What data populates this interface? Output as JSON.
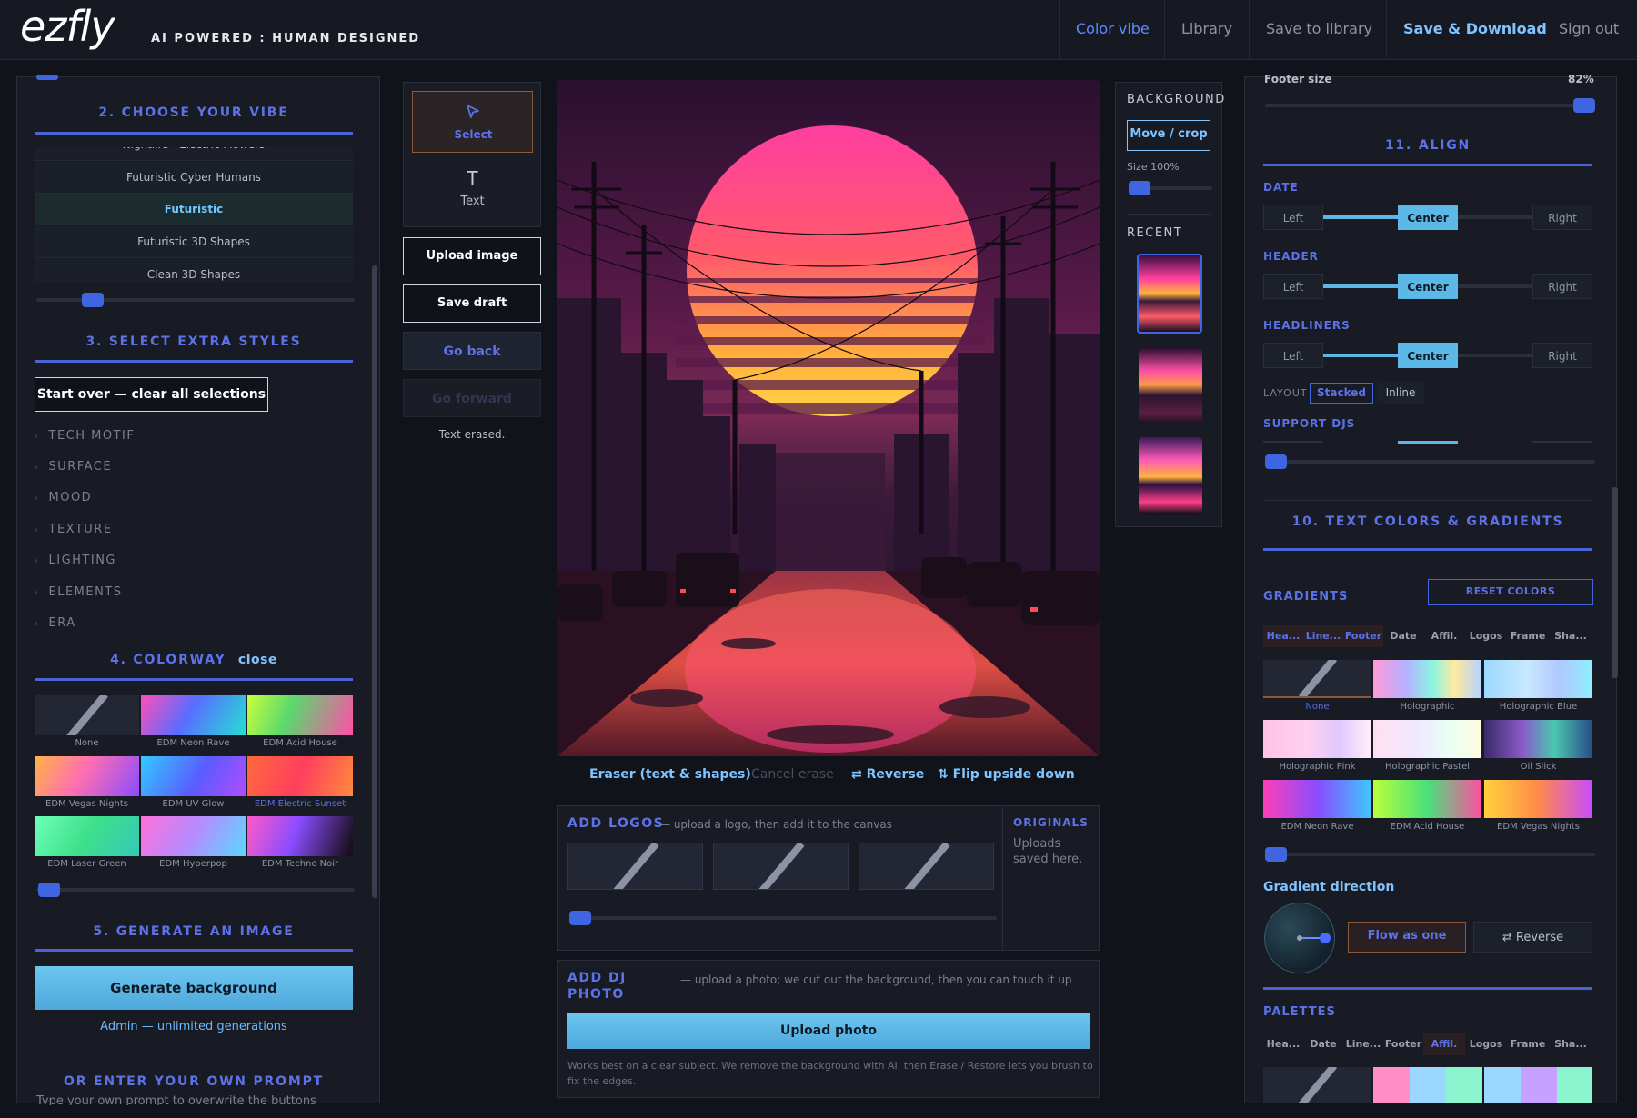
{
  "header": {
    "logo": "ezfly",
    "tagline": "AI POWERED : HUMAN DESIGNED",
    "nav": [
      "Color vibe",
      "Library",
      "Save to library",
      "Save & Download",
      "Sign out"
    ]
  },
  "left": {
    "vibe_title": "2.  CHOOSE YOUR VIBE",
    "vibe_list": [
      "Nightlife - Electric Flowers",
      "Futuristic Cyber Humans",
      "Futuristic",
      "Futuristic 3D Shapes",
      "Clean 3D Shapes"
    ],
    "vibe_selected": "Futuristic",
    "extra_title": "3.  SELECT EXTRA STYLES",
    "start_over": "Start over — clear all selections",
    "styles": [
      "TECH MOTIF",
      "SURFACE",
      "MOOD",
      "TEXTURE",
      "LIGHTING",
      "ELEMENTS",
      "ERA"
    ],
    "colorway_title": "4.  COLORWAY",
    "colorway_close": "close",
    "colorways": [
      "None",
      "EDM Neon Rave",
      "EDM Acid House",
      "EDM Vegas Nights",
      "EDM UV Glow",
      "EDM Electric Sunset",
      "EDM Laser Green",
      "EDM Hyperpop",
      "EDM Techno Noir"
    ],
    "generate_title": "5.  GENERATE AN IMAGE",
    "generate_button": "Generate background",
    "admin_note": "Admin — unlimited generations",
    "prompt_title": "OR ENTER YOUR OWN PROMPT",
    "prompt_hint": "Type your own prompt to overwrite the buttons"
  },
  "tools": {
    "select": "Select",
    "text": "Text",
    "upload_image": "Upload image",
    "save_draft": "Save draft",
    "go_back": "Go back",
    "go_forward": "Go forward",
    "status": "Text erased."
  },
  "canvas_tools": {
    "eraser": "Eraser (text & shapes)",
    "cancel": "Cancel erase",
    "reverse": "Reverse",
    "flip": "Flip upside down"
  },
  "logos": {
    "title": "ADD LOGOS",
    "hint": "— upload a logo, then add it to the canvas",
    "originals_title": "ORIGINALS",
    "originals_hint": "Uploads saved here."
  },
  "dj": {
    "title": "ADD DJ PHOTO",
    "hint": "— upload a photo; we cut out the background, then you can touch it up",
    "button": "Upload photo",
    "note": "Works best on a clear subject. We remove the background with AI, then Erase / Restore lets you brush to fix the edges."
  },
  "background": {
    "title": "BACKGROUND",
    "move_crop": "Move / crop",
    "size": "Size 100%",
    "recent_title": "RECENT"
  },
  "right": {
    "footer_size_label": "Footer size",
    "footer_size_value": "82%",
    "align_title": "11.  ALIGN",
    "date_label": "DATE",
    "header_label": "HEADER",
    "headliners_label": "HEADLINERS",
    "layout_label": "LAYOUT",
    "layout_options": [
      "Stacked",
      "Inline"
    ],
    "support_label": "SUPPORT DJS",
    "align_options": [
      "Left",
      "Center",
      "Right"
    ],
    "colors_title": "10.  TEXT COLORS & GRADIENTS",
    "gradients_label": "GRADIENTS",
    "reset_colors": "RESET COLORS",
    "grad_tabs": [
      "Hea...",
      "Line...",
      "Footer",
      "Date",
      "Affil.",
      "Logos",
      "Frame",
      "Sha..."
    ],
    "gradients": [
      "None",
      "Holographic",
      "Holographic Blue",
      "Holographic Pink",
      "Holographic Pastel",
      "Oil Slick",
      "EDM Neon Rave",
      "EDM Acid House",
      "EDM Vegas Nights"
    ],
    "direction_label": "Gradient direction",
    "flow_as_one": "Flow as one",
    "reverse": "⇄ Reverse",
    "palettes_label": "PALETTES",
    "palette_tabs": [
      "Hea...",
      "Date",
      "Line...",
      "Footer",
      "Affil.",
      "Logos",
      "Frame",
      "Sha..."
    ]
  },
  "colors": {
    "accent": "#5e72e8",
    "cyan": "#5cb8e6",
    "panel": "#181b24",
    "bg": "#11131a"
  }
}
